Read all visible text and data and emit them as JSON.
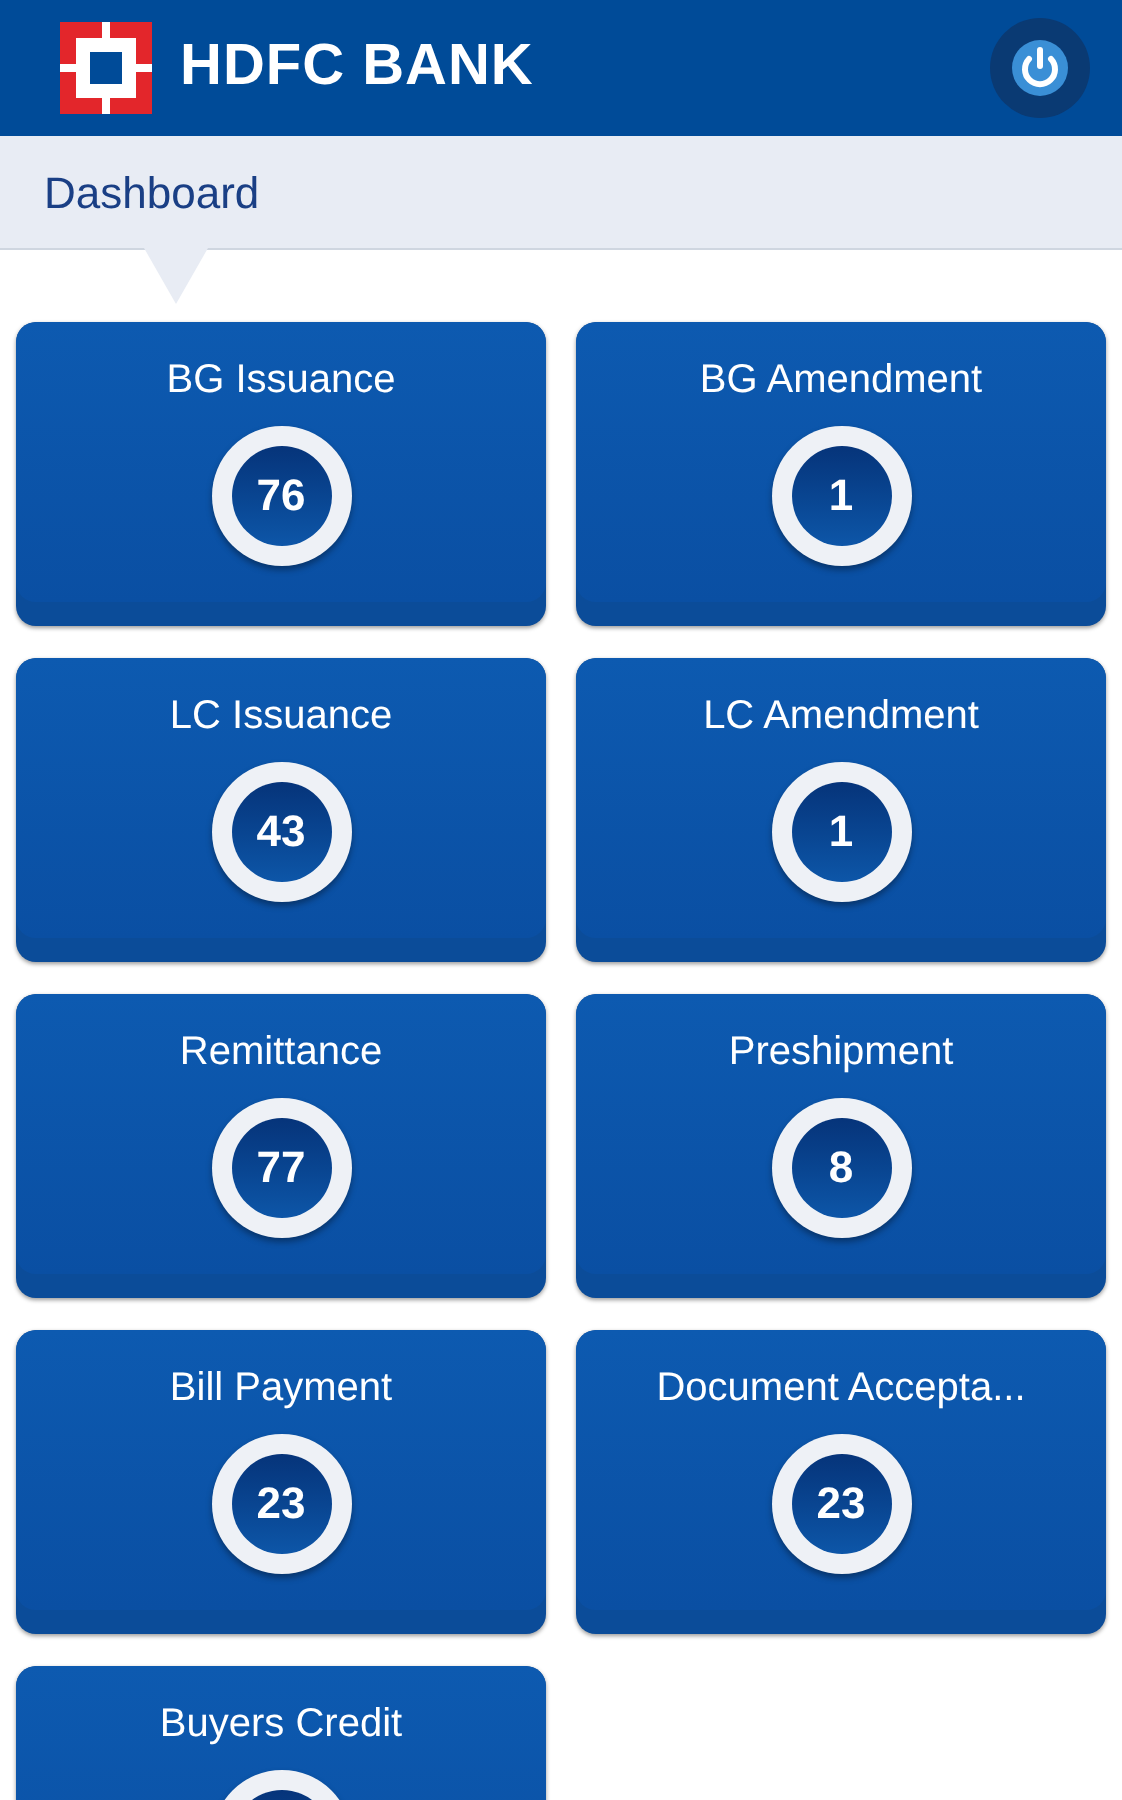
{
  "header": {
    "brand": "HDFC BANK"
  },
  "breadcrumb": {
    "title": "Dashboard"
  },
  "tiles": [
    {
      "title": "BG Issuance",
      "count": "76"
    },
    {
      "title": "BG Amendment",
      "count": "1"
    },
    {
      "title": "LC Issuance",
      "count": "43"
    },
    {
      "title": "LC Amendment",
      "count": "1"
    },
    {
      "title": "Remittance",
      "count": "77"
    },
    {
      "title": "Preshipment",
      "count": "8"
    },
    {
      "title": "Bill Payment",
      "count": "23"
    },
    {
      "title": "Document Accepta...",
      "count": "23"
    },
    {
      "title": "Buyers Credit"
    }
  ]
}
